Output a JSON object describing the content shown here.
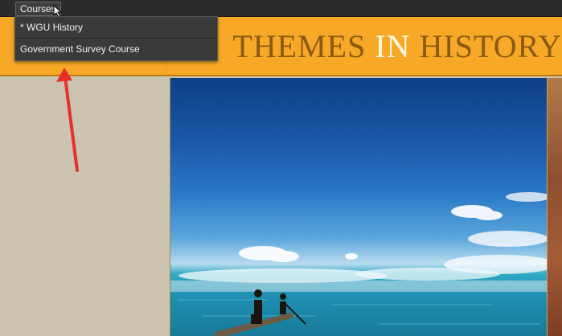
{
  "topbar": {
    "courses_label": "Courses"
  },
  "menu": {
    "items": [
      {
        "label": "* WGU History"
      },
      {
        "label": "Government Survey Course"
      }
    ]
  },
  "banner": {
    "title_part1": "THEMES ",
    "title_highlight": "IN",
    "title_part2": " HISTORY"
  },
  "icons": {
    "cursor": "cursor-arrow-icon",
    "annotation": "red-arrow-icon"
  },
  "colors": {
    "banner": "#f7a826",
    "title": "#8a5a14",
    "title_highlight": "#fff8e8",
    "topbar": "#2c2c2c",
    "annotation_arrow": "#e8302a"
  }
}
